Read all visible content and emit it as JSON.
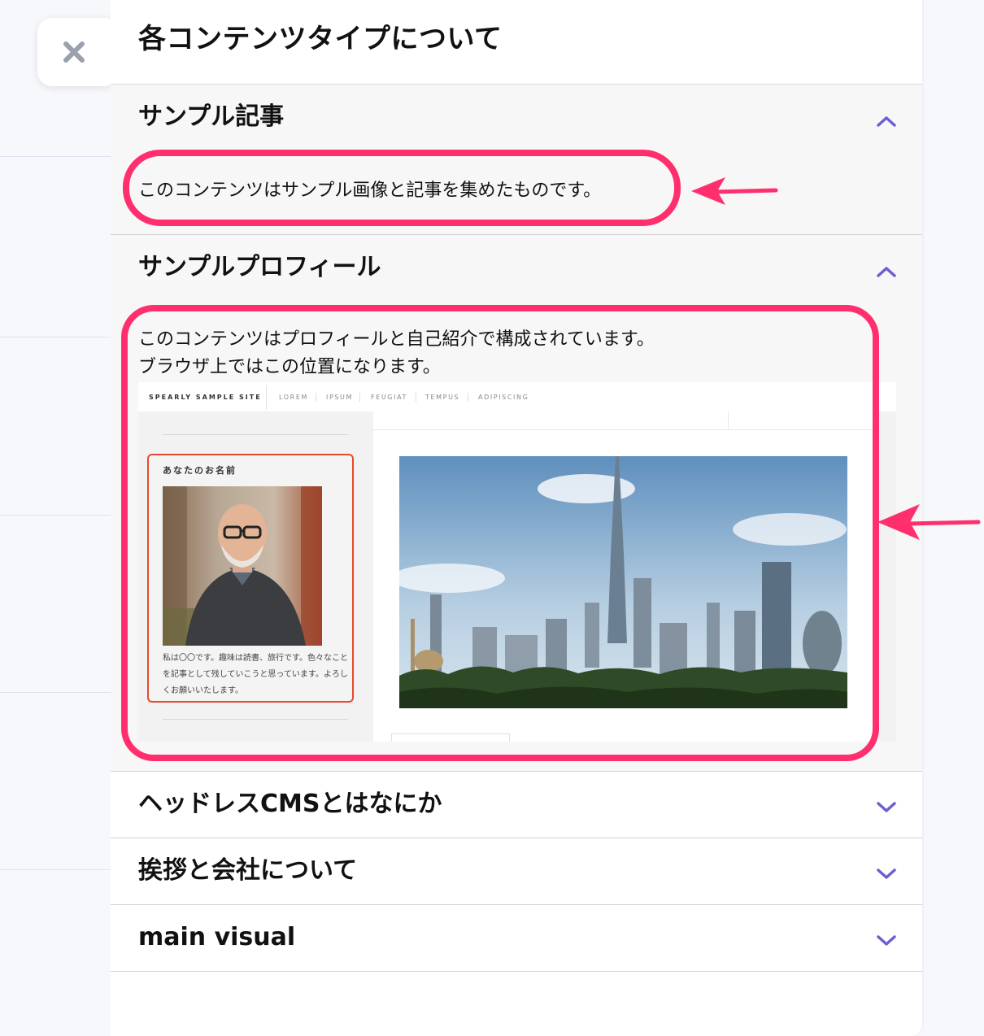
{
  "close_icon": "close-icon",
  "panel": {
    "title": "各コンテンツタイプについて"
  },
  "sections": [
    {
      "title": "サンプル記事",
      "expanded": true,
      "chevron": "chevron-up-icon",
      "body_lines": [
        "このコンテンツはサンプル画像と記事を集めたものです。"
      ]
    },
    {
      "title": "サンプルプロフィール",
      "expanded": true,
      "chevron": "chevron-up-icon",
      "body_lines": [
        "このコンテンツはプロフィールと自己紹介で構成されています。",
        "ブラウザ上ではこの位置になります。"
      ],
      "preview": {
        "brand": "SPEARLY SAMPLE SITE",
        "nav_links": [
          "LOREM",
          "IPSUM",
          "FEUGIAT",
          "TEMPUS",
          "ADIPISCING"
        ],
        "card_name": "あなたのお名前",
        "card_text": "私は〇〇です。趣味は読書、旅行です。色々なことを記事として残していこうと思っています。よろしくお願いいたします。"
      }
    },
    {
      "title": "ヘッドレスCMSとはなにか",
      "expanded": false,
      "chevron": "chevron-down-icon"
    },
    {
      "title": "挨拶と会社について",
      "expanded": false,
      "chevron": "chevron-down-icon"
    },
    {
      "title": "main visual",
      "expanded": false,
      "chevron": "chevron-down-icon"
    }
  ],
  "colors": {
    "accent_chevron": "#6b5fd3",
    "highlight": "#ff2f6e",
    "card_border": "#e64a2e"
  }
}
